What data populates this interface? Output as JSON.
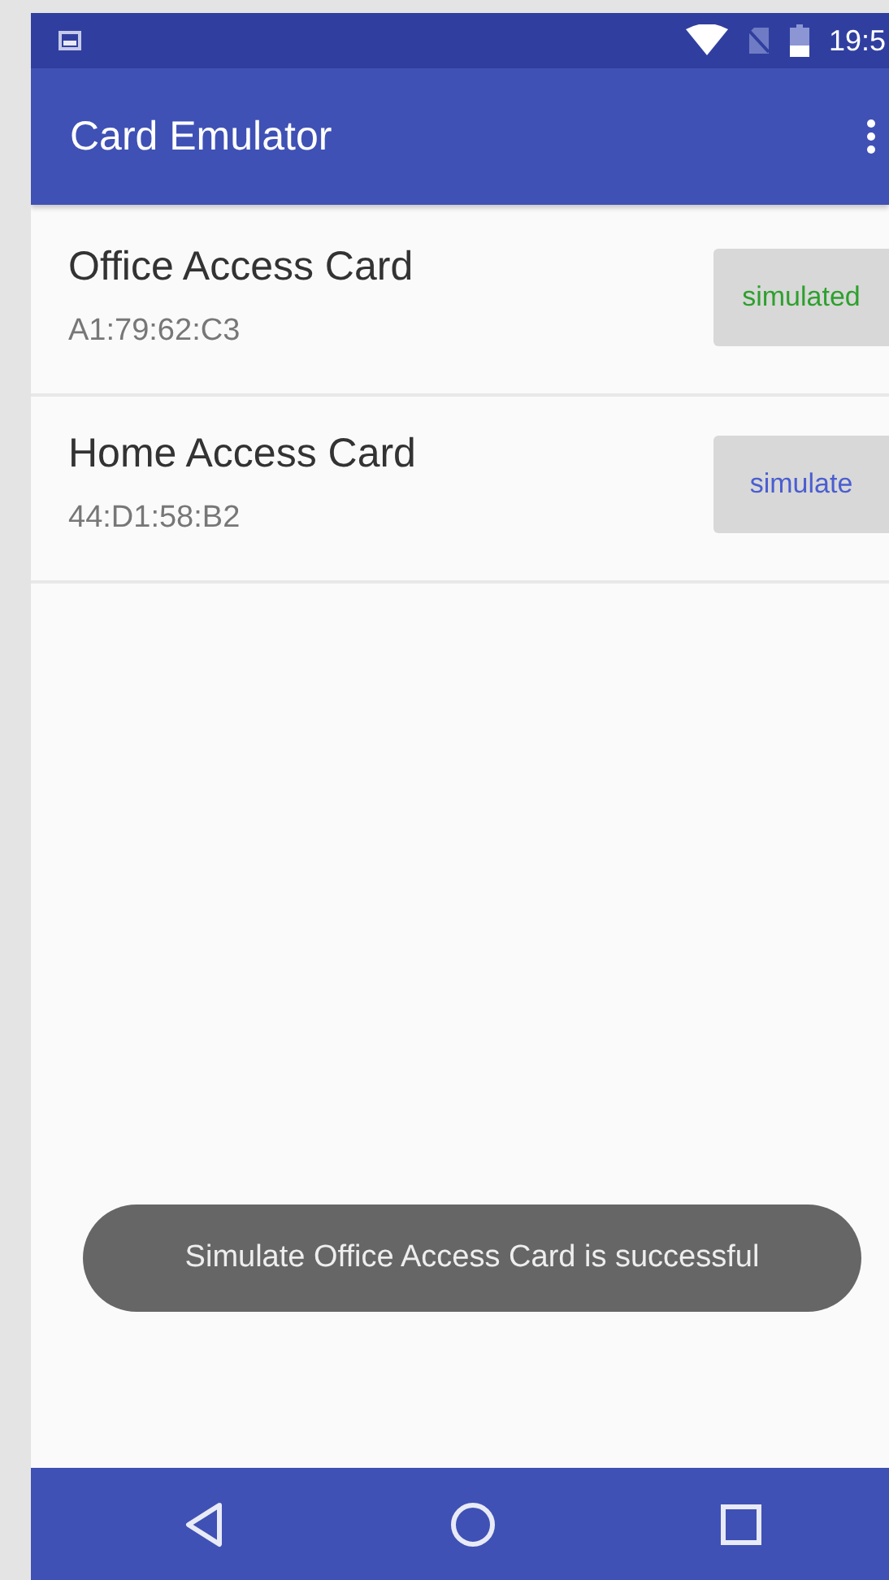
{
  "status_bar": {
    "time": "19:5"
  },
  "toolbar": {
    "title": "Card Emulator"
  },
  "cards": [
    {
      "name": "Office Access Card",
      "id": "A1:79:62:C3",
      "button": "simulated",
      "simulated": true
    },
    {
      "name": "Home Access Card",
      "id": "44:D1:58:B2",
      "button": "simulate",
      "simulated": false
    }
  ],
  "toast": "Simulate Office Access Card is successful"
}
